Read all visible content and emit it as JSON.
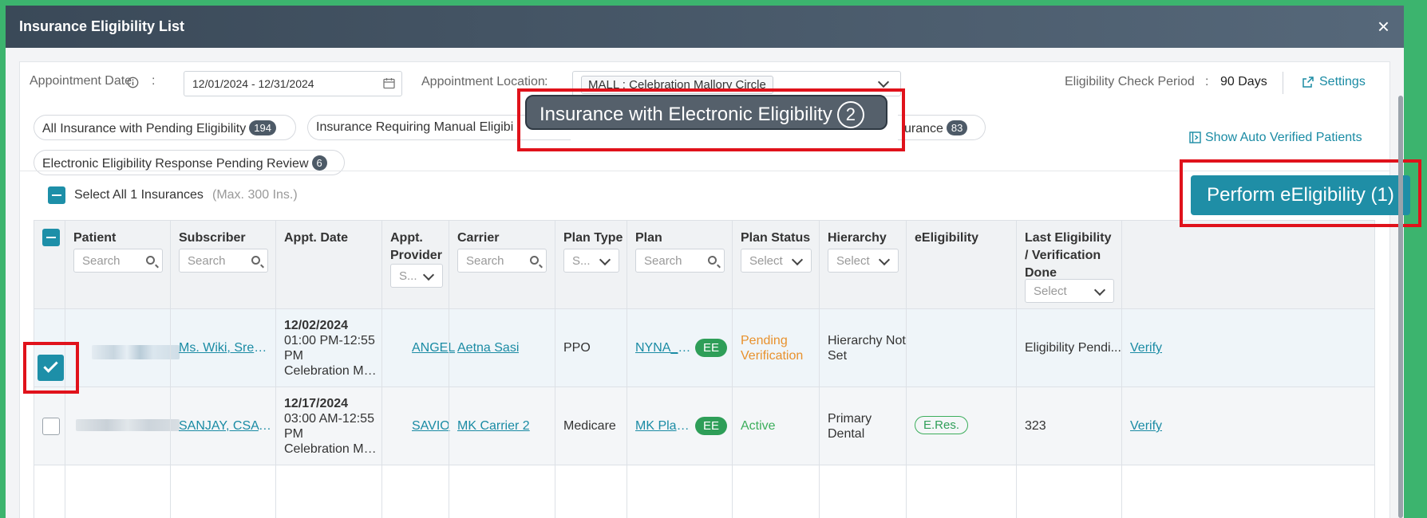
{
  "modal": {
    "title": "Insurance Eligibility List",
    "close_label": "×"
  },
  "filters": {
    "appointment_date_label": "Appointment Date",
    "colon": ":",
    "appointment_date_value": "12/01/2024 - 12/31/2024",
    "appointment_location_label": "Appointment Location",
    "appointment_location_value": "MALL : Celebration Mallory Circle",
    "eligibility_check_period_label": "Eligibility Check Period",
    "eligibility_check_period_value": "90 Days",
    "settings_label": "Settings",
    "show_auto_verified_label": "Show Auto Verified Patients"
  },
  "tabs": [
    {
      "label": "All Insurance with Pending Eligibility",
      "count": "194"
    },
    {
      "label": "Insurance Requiring Manual Eligibi",
      "count": ""
    },
    {
      "label": "Insurance with Electronic Eligibility",
      "count": "2"
    },
    {
      "label": "urance",
      "count": "83"
    },
    {
      "label": "Electronic Eligibility Response Pending Review",
      "count": "6"
    }
  ],
  "select_all": {
    "label": "Select All 1 Insurances",
    "max_note": "(Max. 300 Ins.)"
  },
  "perform_button": {
    "label": "Perform eEligibility (1)"
  },
  "table": {
    "headers": {
      "patient": "Patient",
      "subscriber": "Subscriber",
      "appt_date": "Appt. Date",
      "appt_provider": "Appt. Provider",
      "carrier": "Carrier",
      "plan_type": "Plan Type",
      "plan": "Plan",
      "plan_status": "Plan Status",
      "hierarchy": "Hierarchy",
      "eeligibility": "eEligibility",
      "last_eligibility": "Last Eligibility / Verification Done"
    },
    "filter_placeholders": {
      "search": "Search",
      "select": "Select",
      "short_select": "S..."
    },
    "rows": [
      {
        "subscriber": "Ms. Wiki, Sreejit...",
        "date": "12/02/2024",
        "time": "01:00 PM-12:55",
        "pm": "PM",
        "location": "Celebration Mal...",
        "provider": "ANGEL",
        "carrier": "Aetna Sasi",
        "plan_type": "PPO",
        "plan": "NYNA_P...",
        "plan_badge": "EE",
        "status_line1": "Pending",
        "status_line2": "Verification",
        "hierarchy_line1": "Hierarchy Not",
        "hierarchy_line2": "Set",
        "eeligibility": "",
        "last_eligibility": "Eligibility Pendi...",
        "verify": "Verify",
        "status_color": "#e8912d"
      },
      {
        "subscriber": "SANJAY, CSA D...",
        "date": "12/17/2024",
        "time": "03:00 AM-12:55",
        "pm": "PM",
        "location": "Celebration Mal...",
        "provider": "SAVIO",
        "carrier": "MK Carrier 2",
        "plan_type": "Medicare",
        "plan": "MK Plan ...",
        "plan_badge": "EE",
        "status_line1": "Active",
        "status_line2": "",
        "hierarchy_line1": "Primary",
        "hierarchy_line2": "Dental",
        "eeligibility": "E.Res.",
        "last_eligibility": "323",
        "verify": "Verify",
        "status_color": "#3cae5c"
      }
    ]
  },
  "colors": {
    "accent": "#1d8fa8",
    "header": "#3a4958",
    "highlight": "#e0121b",
    "frame": "#3cb46e"
  }
}
